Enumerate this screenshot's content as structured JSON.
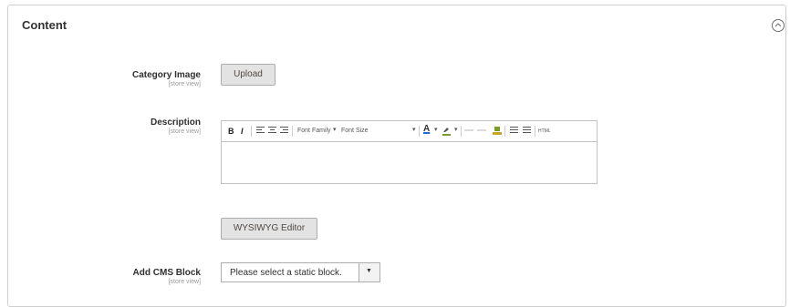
{
  "section": {
    "title": "Content"
  },
  "fields": {
    "category_image": {
      "label": "Category Image",
      "scope": "[store view]",
      "button_label": "Upload"
    },
    "description": {
      "label": "Description",
      "scope": "[store view]",
      "toolbar": {
        "bold": "B",
        "italic": "I",
        "font_family": "Font Family",
        "font_size": "Font Size",
        "text_color": "A",
        "html": "HTML"
      },
      "editor_content": "",
      "wysiwyg_button_label": "WYSIWYG Editor"
    },
    "cms_block": {
      "label": "Add CMS Block",
      "scope": "[store view]",
      "selected_value": "Please select a static block.",
      "dropdown_arrow": "▼"
    }
  }
}
